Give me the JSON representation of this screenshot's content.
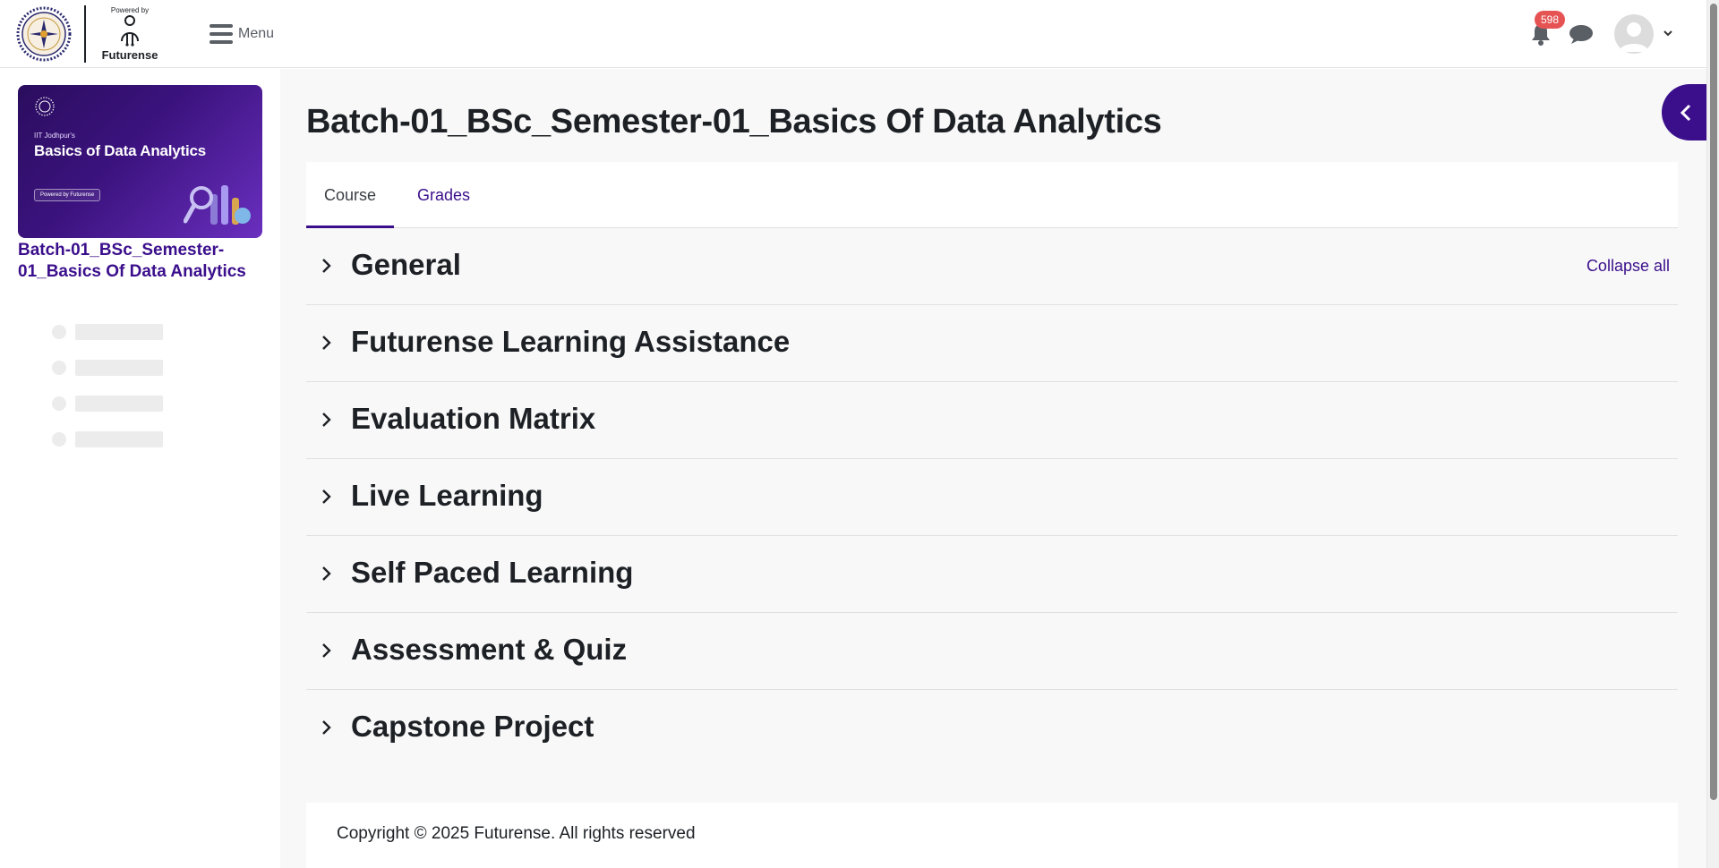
{
  "header": {
    "brand_powered_by": "Powered by",
    "brand_name": "Futurense",
    "menu_label": "Menu",
    "notification_count": "598"
  },
  "sidebar": {
    "course_card": {
      "small_text": "IIT Jodhpur's",
      "title": "Basics of Data Analytics",
      "pill": "Powered by Futurense"
    },
    "course_title": "Batch-01_BSc_Semester-01_Basics Of Data Analytics"
  },
  "main": {
    "page_title": "Batch-01_BSc_Semester-01_Basics Of Data Analytics",
    "tabs": [
      {
        "label": "Course",
        "active": true
      },
      {
        "label": "Grades",
        "active": false
      }
    ],
    "collapse_all_label": "Collapse all",
    "sections": [
      {
        "title": "General"
      },
      {
        "title": "Futurense Learning Assistance"
      },
      {
        "title": "Evaluation Matrix"
      },
      {
        "title": "Live Learning"
      },
      {
        "title": "Self Paced Learning"
      },
      {
        "title": "Assessment & Quiz"
      },
      {
        "title": "Capstone Project"
      }
    ]
  },
  "footer": {
    "copyright": "Copyright © 2025 Futurense. All rights reserved"
  },
  "colors": {
    "accent": "#3b0f8c",
    "badge": "#e55353",
    "page_bg": "#f8f8f8"
  }
}
